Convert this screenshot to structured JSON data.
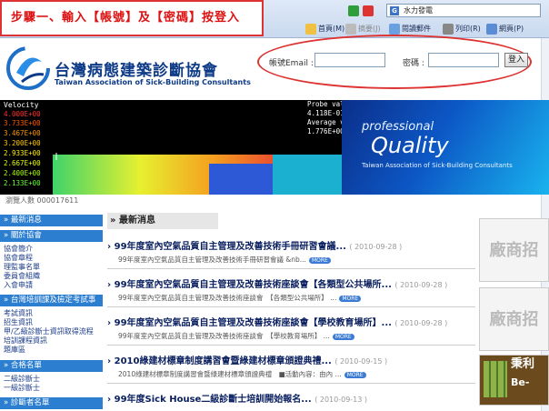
{
  "browser": {
    "search_value": "水力發電",
    "search_logo": "G",
    "toolbar_items": [
      "首頁(M)",
      "摘要(J)",
      "閱讀郵件",
      "列印(R)",
      "網頁(P)"
    ],
    "icons": [
      "home-icon",
      "feed-icon",
      "mail-icon",
      "print-icon",
      "page-icon",
      "refresh-icon",
      "stop-icon",
      "search-icon"
    ]
  },
  "callout": {
    "text": "步驟一、輸入【帳號】及【密碼】按登入"
  },
  "header": {
    "title_zh": "台灣病態建築診斷協會",
    "title_en": "Taiwan  Association of Sick-Building Consultants",
    "brand_color": "#0d3a86"
  },
  "login": {
    "email_label": "帳號Email :",
    "password_label": "密碼 :",
    "button_label": "登入",
    "email_value": "",
    "password_value": ""
  },
  "banner": {
    "velocity_label": "Velocity",
    "velocity_scale": [
      {
        "value": "4.000E+00",
        "color": "#ff3030"
      },
      {
        "value": "3.733E+00",
        "color": "#ff5a00"
      },
      {
        "value": "3.467E+00",
        "color": "#ff9900"
      },
      {
        "value": "3.200E+00",
        "color": "#ffcc00"
      },
      {
        "value": "2.933E+00",
        "color": "#ffee00"
      },
      {
        "value": "2.667E+00",
        "color": "#e8ff00"
      },
      {
        "value": "2.400E+00",
        "color": "#aaff00"
      },
      {
        "value": "2.133E+00",
        "color": "#66ff33"
      }
    ],
    "probe_line1": "Probe value",
    "probe_line2": "4.118E-01",
    "probe_line3": "Average value",
    "probe_line4": "1.776E+00",
    "quality_small": "professional",
    "quality_big": "Quality",
    "quality_sub": "Taiwan Association of Sick-Building Consultants"
  },
  "visitor_label": "瀏覽人數 000017611",
  "sidebar": {
    "sections": [
      {
        "title": "» 最新消息",
        "items": []
      },
      {
        "title": "» 關於協會",
        "items": [
          "協會簡介",
          "協會章程",
          "理監事名單",
          "委員會組織",
          "入會申請"
        ]
      },
      {
        "title": "» 台灣培訓課及檢定考試事宜",
        "items": [
          "考試資訊",
          "招生資訊",
          "甲/乙級診斷士資訊取得流程",
          "培訓課程資訊",
          "題庫區"
        ]
      },
      {
        "title": "» 合格名單",
        "items": [
          "二級診斷士",
          "一級診斷士"
        ]
      },
      {
        "title": "» 診斷者名單",
        "items": []
      }
    ]
  },
  "news": {
    "header": "最新消息",
    "more_label": "MORE",
    "items": [
      {
        "title": "99年度室內空氣品質自主管理及改善技術手冊研習會議...",
        "date": "( 2010-09-28 )",
        "desc": "99年度室內空氣品質自主管理及改善技術手冊研習會議 &nb..."
      },
      {
        "title": "99年度室內空氣品質自主管理及改善技術座談會【各類型公共場所...",
        "date": "( 2010-09-28 )",
        "desc": "99年度室內空氣品質自主管理及改善技術座談會　【各類型公共場所】 ..."
      },
      {
        "title": "99年度室內空氣品質自主管理及改善技術座談會【學校教育場所】...",
        "date": "( 2010-09-28 )",
        "desc": "99年度室內空氣品質自主管理及改善技術座談會　【學校教育場所】 ..."
      },
      {
        "title": "2010綠建材標章制度講習會暨綠建材標章頒證典禮...",
        "date": "( 2010-09-15 )",
        "desc": "2010綠建材標章制度講習會暨綠建材標章頒證典禮　■活動內容：由內 ..."
      },
      {
        "title": "99年度Sick House二級診斷士培訓開始報名...",
        "date": "( 2010-09-13 )",
        "desc": ""
      }
    ]
  },
  "ads": {
    "slot1": "廠商招",
    "slot2": "廠商招",
    "slot3_title": "秉利",
    "slot3_sub": "Be-"
  }
}
